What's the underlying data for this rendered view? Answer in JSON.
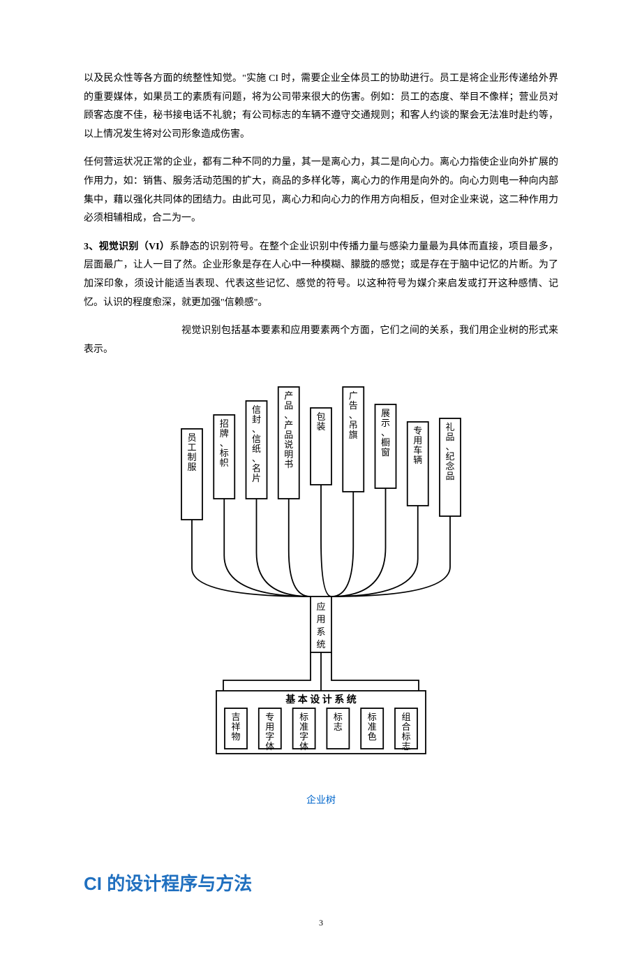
{
  "p1": "以及民众性等各方面的统整性知觉。\"实施 CI 时，需要企业全体员工的协助进行。员工是将企业形传递给外界的重要媒体，如果员工的素质有问题，将为公司带来很大的伤害。例如：员工的态度、举目不像样；营业员对顾客态度不佳，秘书接电话不礼貌；有公司标志的车辆不遵守交通规则；和客人约谈的聚会无法准时赴约等，以上情况发生将对公司形象造成伤害。",
  "p2": "任何营运状况正常的企业，都有二种不同的力量，其一是离心力，其二是向心力。离心力指使企业向外扩展的作用力，如：销售、服务活动范围的扩大，商品的多样化等，离心力的作用是向外的。向心力则电一种向内部集中，藉以强化共同体的团结力。由此可见，离心力和向心力的作用方向相反，但对企业来说，这二种作用力必须相辅相成，合二为一。",
  "p3_lead": "3、视觉识别（VI）",
  "p3_body": "系静态的识别符号。在整个企业识别中传播力量与感染力量最为具体而直接，项目最多，层面最广，让人一目了然。企业形象是存在人心中一种模糊、朦胧的感觉；或是存在于脑中记忆的片断。为了加深印象，须设计能适当表现、代表这些记忆、感觉的符号。以这种符号为媒介来启发或打开这种感情、记忆。认识的程度愈深，就更加强\"信赖感\"。",
  "p3_tail": "视觉识别包括基本要素和应用要素两个方面，它们之间的关系，我们用企业树的形式来表示。",
  "diagram": {
    "upper": [
      "员工制服",
      "招牌、标帜",
      "信封、信纸、名片",
      "产品、产品说明书",
      "包装",
      "广告、吊旗",
      "展示、橱窗",
      "专用车辆",
      "礼品、纪念品"
    ],
    "center": "应用系统",
    "basic_title": "基 本 设 计 系 统",
    "lower": [
      "吉祥物",
      "专用字体",
      "标准字体",
      "标志",
      "标准色",
      "组合标志"
    ],
    "caption": "企业树"
  },
  "heading": "CI 的设计程序与方法",
  "page_number": "3"
}
